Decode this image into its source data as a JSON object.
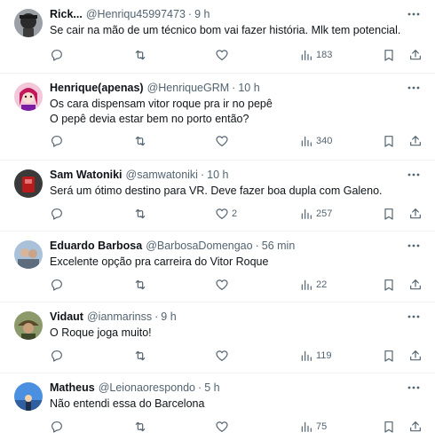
{
  "tweets": [
    {
      "name": "Rick...",
      "handle": "@Henriqu45997473",
      "separator": "·",
      "time": "9 h",
      "text": "Se cair na mão de um técnico bom vai fazer história. Mlk tem potencial.",
      "likes": "",
      "views": "183",
      "avatar_color": "#2b2b2b"
    },
    {
      "name": "Henrique(apenas)",
      "handle": "@HenriqueGRM",
      "separator": "·",
      "time": "10 h",
      "text": "Os cara dispensam vitor roque pra ir no pepê\nO pepê devia estar bem no porto então?",
      "likes": "",
      "views": "340",
      "avatar_color": "#c2185b"
    },
    {
      "name": "Sam Watoniki",
      "handle": "@samwatoniki",
      "separator": "·",
      "time": "10 h",
      "text": "Será um ótimo destino para VR. Deve fazer boa dupla com Galeno.",
      "likes": "2",
      "views": "257",
      "avatar_color": "#b71c1c"
    },
    {
      "name": "Eduardo Barbosa",
      "handle": "@BarbosaDomengao",
      "separator": "·",
      "time": "56 min",
      "text": "Excelente opção pra carreira do Vitor Roque",
      "likes": "",
      "views": "22",
      "avatar_color": "#7a8fa6"
    },
    {
      "name": "Vidaut",
      "handle": "@ianmarinss",
      "separator": "·",
      "time": "9 h",
      "text": "O Roque joga muito!",
      "likes": "",
      "views": "119",
      "avatar_color": "#6d5a3a"
    },
    {
      "name": "Matheus",
      "handle": "@Leionaorespondo",
      "separator": "·",
      "time": "5 h",
      "text": "Não entendi essa do Barcelona",
      "likes": "",
      "views": "75",
      "avatar_color": "#3a7bd5"
    }
  ],
  "icons": {
    "more": "more-dots-icon",
    "reply": "reply-icon",
    "retweet": "retweet-icon",
    "like": "like-icon",
    "views": "views-icon",
    "bookmark": "bookmark-icon",
    "share": "share-icon"
  },
  "colors": {
    "text": "#0f1419",
    "secondary": "#536471",
    "divider": "#eff3f4"
  }
}
